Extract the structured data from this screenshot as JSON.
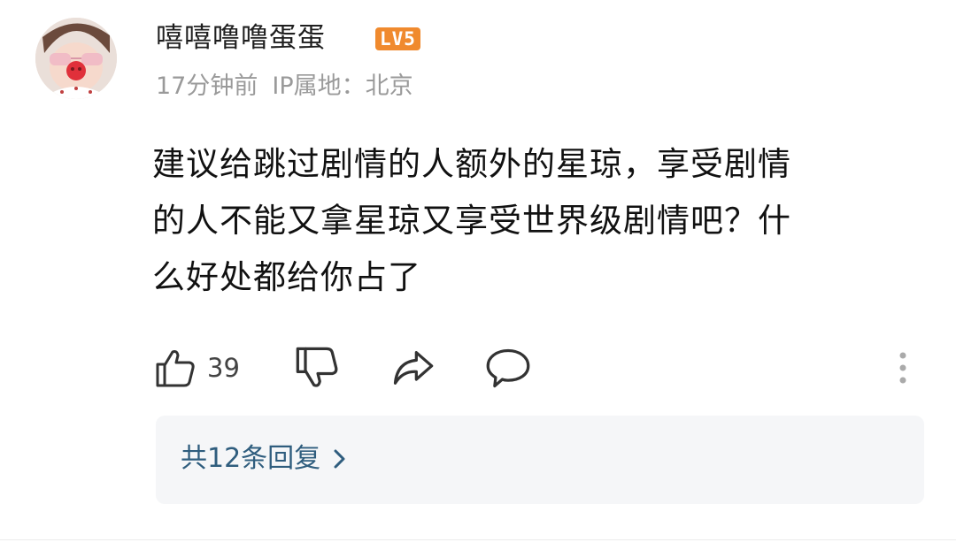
{
  "comment": {
    "username": "嘻嘻噜噜蛋蛋",
    "level_badge": "LV5",
    "time_ago": "17分钟前",
    "ip_location": "IP属地：北京",
    "text_lines": [
      "建议给跳过剧情的人额外的星琼，享受剧情",
      "的人不能又拿星琼又享受世界级剧情吧？什",
      "么好处都给你占了"
    ],
    "like_count": "39",
    "replies_label": "共12条回复",
    "icons": {
      "like": "thumbs-up-icon",
      "dislike": "thumbs-down-icon",
      "share": "share-arrow-icon",
      "reply": "speech-bubble-icon",
      "more": "vertical-dots-icon",
      "chevron": "chevron-right-icon"
    },
    "colors": {
      "level_badge": "#f08a2e",
      "replies_link": "#2f5d7e",
      "meta_text": "#9a9a9a",
      "replies_background": "#f5f6f8"
    }
  }
}
